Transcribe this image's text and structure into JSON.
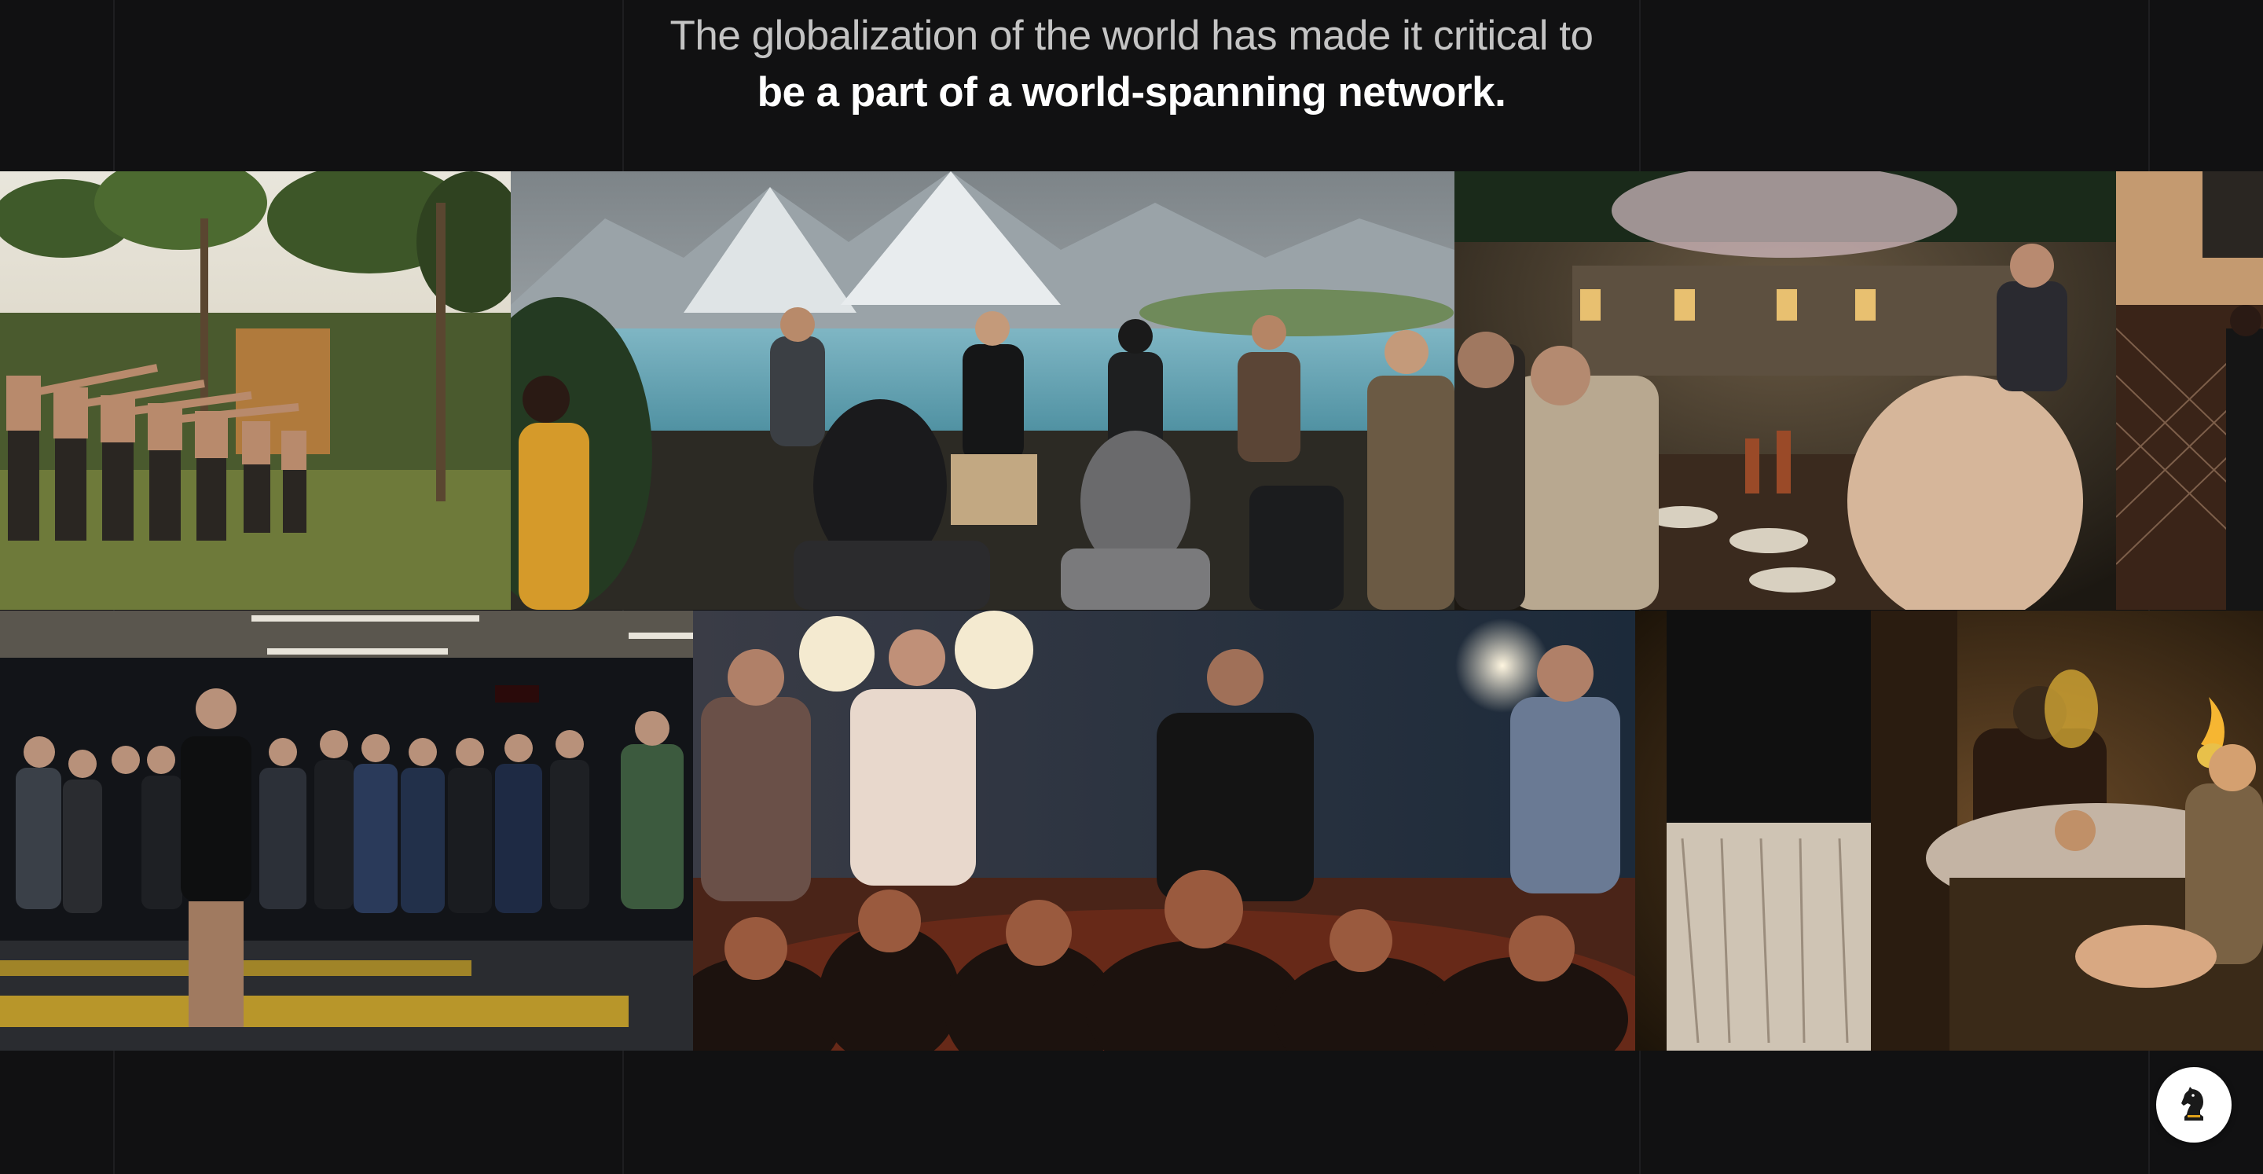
{
  "heading": {
    "line1": "The globalization of the world has made it critical to",
    "line2": "be a part of a world-spanning network."
  },
  "gallery": {
    "photos": [
      {
        "subject": "outdoor-training"
      },
      {
        "subject": "mountain-lake-group"
      },
      {
        "subject": "dinner-toast"
      },
      {
        "subject": "fight-cage"
      },
      {
        "subject": "gym-lineup"
      },
      {
        "subject": "night-gathering"
      },
      {
        "subject": "lounge-flambe"
      }
    ]
  },
  "colors": {
    "background": "#111112",
    "heading_muted": "#c4c4c4",
    "heading_strong": "#ffffff",
    "badge_bg": "#ffffff",
    "badge_icon": "#1a1a1a",
    "badge_accent": "#e0a21a"
  },
  "badge": {
    "icon": "knight-chess-icon"
  }
}
